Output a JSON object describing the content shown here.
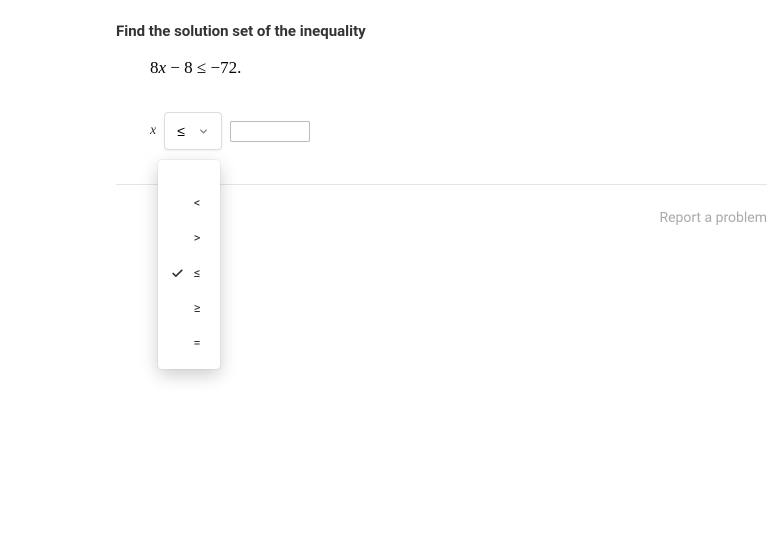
{
  "prompt": "Find the solution set of the inequality",
  "equation": {
    "raw": "8x − 8 ≤ −72.",
    "lhs_coeff": "8",
    "lhs_var": "x",
    "lhs_const_op": " − ",
    "lhs_const": "8",
    "rel": " ≤ ",
    "rhs": "−72",
    "tail": "."
  },
  "answer": {
    "variable": "x",
    "selected": "≤",
    "value": ""
  },
  "dropdown": {
    "options": [
      {
        "label": "<",
        "selected": false
      },
      {
        "label": ">",
        "selected": false
      },
      {
        "label": "≤",
        "selected": true
      },
      {
        "label": "≥",
        "selected": false
      },
      {
        "label": "=",
        "selected": false
      }
    ]
  },
  "footer": {
    "report": "Report a problem"
  }
}
